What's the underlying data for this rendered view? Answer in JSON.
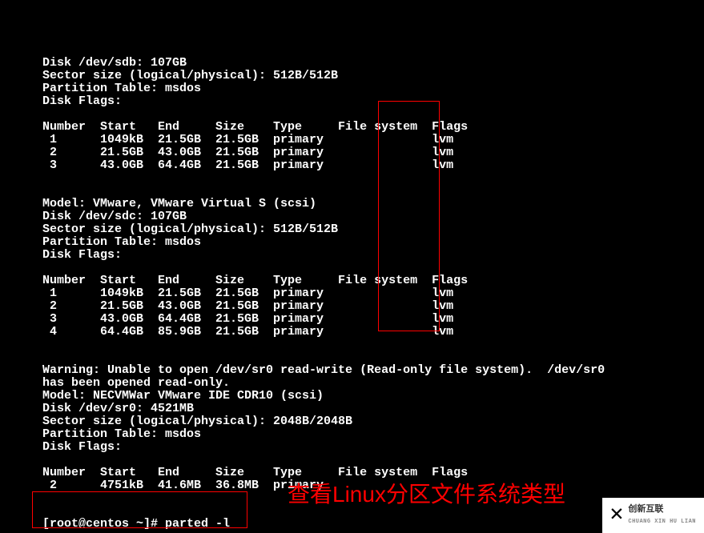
{
  "disk_sdb": {
    "disk_line": "Disk /dev/sdb: 107GB",
    "sector_line": "Sector size (logical/physical): 512B/512B",
    "pt_line": "Partition Table: msdos",
    "flags_line": "Disk Flags:",
    "header": "Number  Start   End     Size    Type     File system  Flags",
    "rows": [
      " 1      1049kB  21.5GB  21.5GB  primary               lvm",
      " 2      21.5GB  43.0GB  21.5GB  primary               lvm",
      " 3      43.0GB  64.4GB  21.5GB  primary               lvm"
    ]
  },
  "disk_sdc": {
    "model_line": "Model: VMware, VMware Virtual S (scsi)",
    "disk_line": "Disk /dev/sdc: 107GB",
    "sector_line": "Sector size (logical/physical): 512B/512B",
    "pt_line": "Partition Table: msdos",
    "flags_line": "Disk Flags:",
    "header": "Number  Start   End     Size    Type     File system  Flags",
    "rows": [
      " 1      1049kB  21.5GB  21.5GB  primary               lvm",
      " 2      21.5GB  43.0GB  21.5GB  primary               lvm",
      " 3      43.0GB  64.4GB  21.5GB  primary               lvm",
      " 4      64.4GB  85.9GB  21.5GB  primary               lvm"
    ]
  },
  "warning": {
    "line1": "Warning: Unable to open /dev/sr0 read-write (Read-only file system).  /dev/sr0",
    "line2": "has been opened read-only."
  },
  "disk_sr0": {
    "model_line": "Model: NECVMWar VMware IDE CDR10 (scsi)",
    "disk_line": "Disk /dev/sr0: 4521MB",
    "sector_line": "Sector size (logical/physical): 2048B/2048B",
    "pt_line": "Partition Table: msdos",
    "flags_line": "Disk Flags:",
    "header": "Number  Start   End     Size    Type     File system  Flags",
    "rows": [
      " 2      4751kB  41.6MB  36.8MB  primary"
    ]
  },
  "prompt": {
    "text": "[root@centos ~]# parted -l"
  },
  "annotation": {
    "chinese": "查看Linux分区文件系统类型"
  },
  "watermark": {
    "cn": "创新互联",
    "en": "CHUANG XIN HU LIAN"
  }
}
